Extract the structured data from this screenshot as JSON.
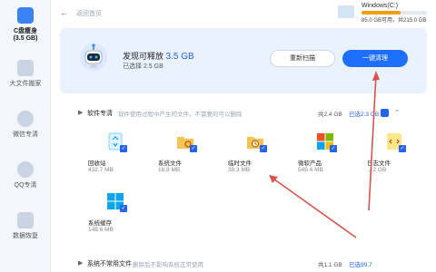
{
  "sidebar": {
    "items": [
      {
        "label": "C盘瘦身",
        "sub": "(3.5 GB)"
      },
      {
        "label": "大文件搬家"
      },
      {
        "label": "微信专清"
      },
      {
        "label": "QQ专清"
      },
      {
        "label": "数据恢复"
      }
    ]
  },
  "topbar": {
    "back_label": "返回首页"
  },
  "disk": {
    "name": "Windows(C:)",
    "usage_text": "85.0 GB可用，共215.0 GB",
    "used_fraction": 0.6
  },
  "hero": {
    "title_prefix": "发现可释放",
    "title_value": "3.5 GB",
    "selected_text": "已选择 2.5 GB",
    "rescan_label": "重新扫描",
    "clean_label": "一键清理"
  },
  "software_section": {
    "title": "软件专清",
    "desc": "软件使用过程中产生的文件，不需要的可以删除",
    "total": "共2.4 GB",
    "selected": "已选2.3 GB"
  },
  "tiles": [
    {
      "name": "回收站",
      "size": "432.7 MB",
      "icon": "recycle-bin-icon"
    },
    {
      "name": "系统文件",
      "size": "18.8 MB",
      "icon": "system-folder-icon"
    },
    {
      "name": "临时文件",
      "size": "38.3 MB",
      "icon": "temp-folder-icon"
    },
    {
      "name": "微软产品",
      "size": "549.4 MB",
      "icon": "microsoft-icon"
    },
    {
      "name": "日志文件",
      "size": "…2 GB",
      "icon": "log-file-icon"
    },
    {
      "name": "系统缓存",
      "size": "148.6 MB",
      "icon": "windows-icon"
    }
  ],
  "bottom_section": {
    "title": "系统不常用文件",
    "desc": "删除后不影响系统正常使用",
    "total": "共1.1 GB",
    "selected": "已选99.7"
  },
  "colors": {
    "accent": "#1f6fff",
    "hero_bg": "#eaf2ff",
    "arrow": "#d9534f"
  }
}
